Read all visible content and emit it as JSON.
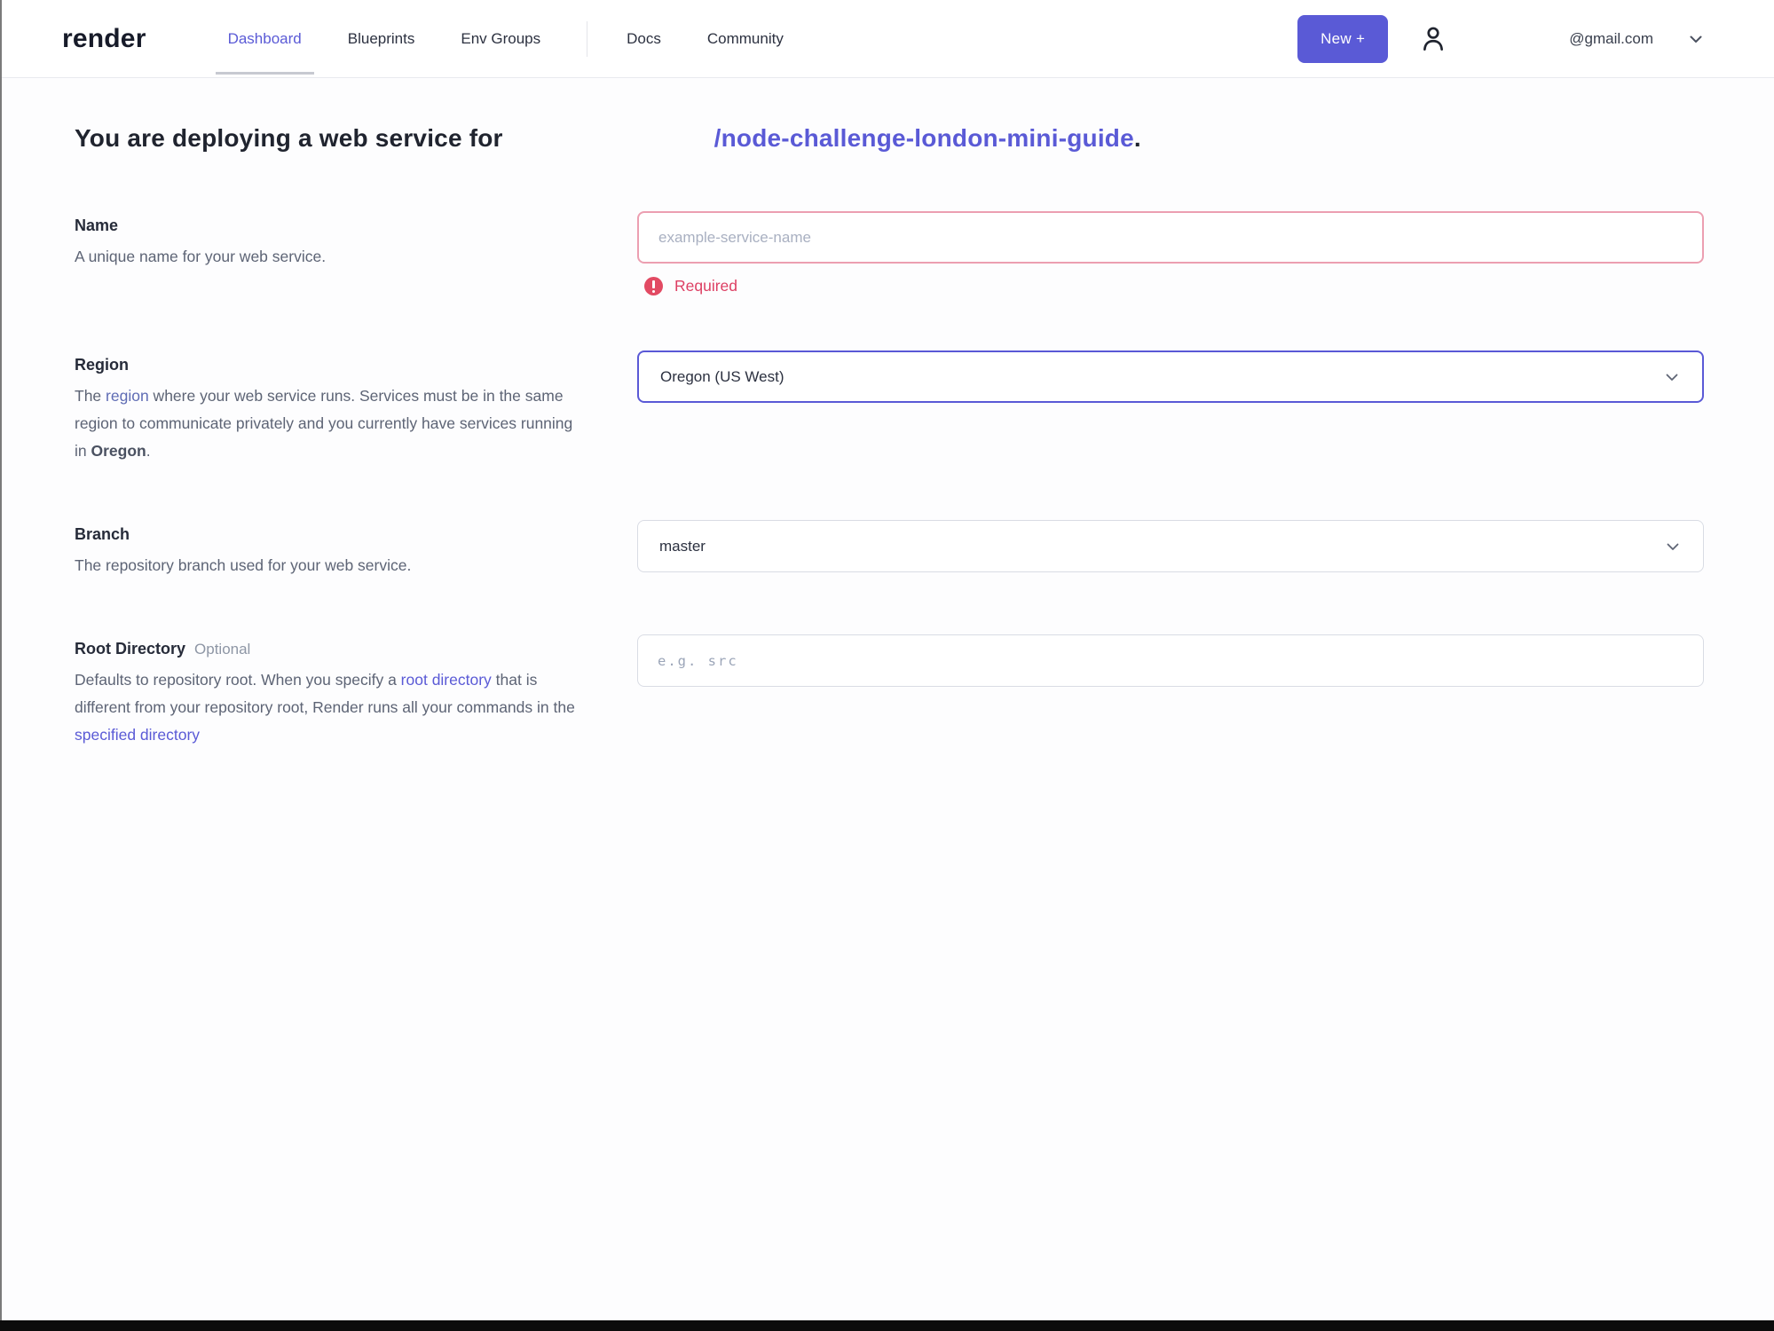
{
  "header": {
    "logo": "render",
    "nav": [
      {
        "label": "Dashboard"
      },
      {
        "label": "Blueprints"
      },
      {
        "label": "Env Groups"
      },
      {
        "label": "Docs"
      },
      {
        "label": "Community"
      }
    ],
    "new_button_label": "New +",
    "account": {
      "email": "@gmail.com"
    }
  },
  "page": {
    "heading_prefix": "You are deploying a web service for",
    "repo_link": "/node-challenge-london-mini-guide",
    "heading_suffix": "."
  },
  "form": {
    "name": {
      "label": "Name",
      "description": "A unique name for your web service.",
      "placeholder": "example-service-name",
      "value": "",
      "error": "Required"
    },
    "region": {
      "label": "Region",
      "desc_1": "The ",
      "desc_link": "region",
      "desc_2": " where your web service runs. Services must be in the same region to communicate privately and you currently have services running in ",
      "desc_bold": "Oregon",
      "desc_3": ".",
      "value": "Oregon (US West)"
    },
    "branch": {
      "label": "Branch",
      "description": "The repository branch used for your web service.",
      "value": "master"
    },
    "root_directory": {
      "label": "Root Directory",
      "optional_tag": "Optional",
      "desc_1": "Defaults to repository root. When you specify a ",
      "desc_link_1": "root directory",
      "desc_2": " that is different from your repository root, Render runs all your commands in the ",
      "desc_link_2": "specified directory",
      "placeholder": "e.g. src",
      "value": ""
    }
  },
  "colors": {
    "accent_purple": "#5a5ad6",
    "error_red": "#dd3f63",
    "error_border_pink": "#ec9fb1"
  }
}
